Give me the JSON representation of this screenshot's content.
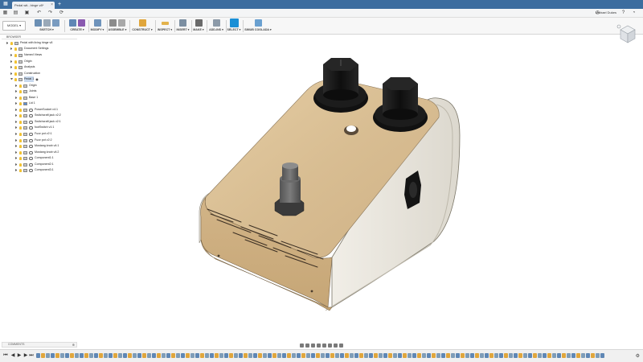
{
  "tab": {
    "title": "Pedal wit...hinge v8*",
    "close": "×",
    "add": "+"
  },
  "user": {
    "name": "Michael Dukes"
  },
  "toolbar": {
    "mode": "MODEL ▾",
    "groups": [
      "SKETCH ▾",
      "CREATE ▾",
      "MODIFY ▾",
      "ASSEMBLE ▾",
      "CONSTRUCT ▾",
      "INSPECT ▾",
      "INSERT ▾",
      "MAKE ▾",
      "ADD-INS ▾",
      "SELECT ▾",
      "SIMUB COGLADA ▾"
    ]
  },
  "browser": {
    "title": "BROWSER",
    "items": [
      "Pedal with living hinge v8",
      "Document Settings",
      "Named Views",
      "Origin",
      "Analysis",
      "Construction",
      "Pedal 1",
      "Origin",
      "Joints",
      "Base 1",
      "Lid 1",
      "PowerSocket v4:1",
      "Switchcraft jack v2:2",
      "Switchcraft jack v2:1",
      "footSwitch v1:1",
      "Fuzz pot v2:1",
      "Fuzz pot v2:2",
      "Mustang knob v4:1",
      "Mustang knob v4:2",
      "Component1:1",
      "Component2:1",
      "Component3:1"
    ]
  },
  "comments": {
    "label": "COMMENTS"
  },
  "colors": {
    "tabbar": "#3c6d9f",
    "wood": "#d9bf95",
    "panel": "#ece9e1",
    "knob": "#141414",
    "select": "#1a8fd6"
  }
}
